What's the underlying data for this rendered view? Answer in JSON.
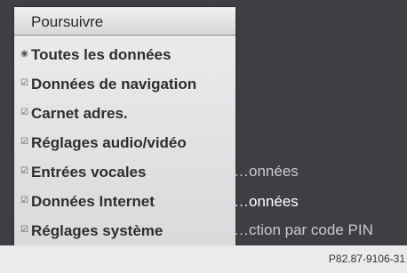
{
  "menu": {
    "header": "Poursuivre",
    "items": [
      {
        "label": "Toutes les données",
        "icon": "radio-dot-icon",
        "mark": "◉"
      },
      {
        "label": "Données de navigation",
        "icon": "check-icon",
        "mark": "☑"
      },
      {
        "label": "Carnet adres.",
        "icon": "check-icon",
        "mark": "☑"
      },
      {
        "label": "Réglages audio/vidéo",
        "icon": "check-icon",
        "mark": "☑"
      },
      {
        "label": "Entrées vocales",
        "icon": "check-icon",
        "mark": "☑"
      },
      {
        "label": "Données Internet",
        "icon": "check-icon",
        "mark": "☑"
      },
      {
        "label": "Réglages système",
        "icon": "check-icon",
        "mark": "☑"
      }
    ]
  },
  "background": {
    "items": [
      "…onnées",
      "…onnées",
      "…ction par code PIN"
    ]
  },
  "footer": {
    "ref": "P82.87-9106-31"
  }
}
